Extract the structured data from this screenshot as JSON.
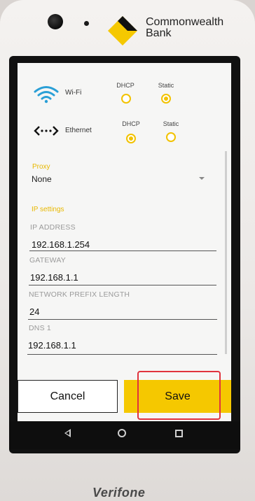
{
  "brand": {
    "line1": "Commonwealth",
    "line2": "Bank",
    "logo_color": "#f5c800"
  },
  "network": {
    "wifi": {
      "label": "Wi-Fi",
      "icon": "wifi-icon",
      "col1": "DHCP",
      "col2": "Static",
      "selected": "Static"
    },
    "ethernet": {
      "label": "Ethernet",
      "icon": "ethernet-icon",
      "col1": "DHCP",
      "col2": "Static",
      "selected": "DHCP"
    }
  },
  "proxy": {
    "label": "Proxy",
    "value": "None"
  },
  "ip_settings": {
    "label": "IP settings",
    "fields": [
      {
        "label": "IP ADDRESS",
        "value": "192.168.1.254"
      },
      {
        "label": "GATEWAY",
        "value": "192.168.1.1"
      },
      {
        "label": "NETWORK PREFIX LENGTH",
        "value": "24"
      },
      {
        "label": "DNS 1",
        "value": "192.168.1.1"
      }
    ]
  },
  "buttons": {
    "cancel": "Cancel",
    "save": "Save"
  },
  "colors": {
    "accent": "#f5c800",
    "highlight": "#e0333d"
  },
  "device_brand": "Verifone",
  "navbar": {
    "back": "back-icon",
    "home": "home-icon",
    "recents": "recents-icon"
  }
}
